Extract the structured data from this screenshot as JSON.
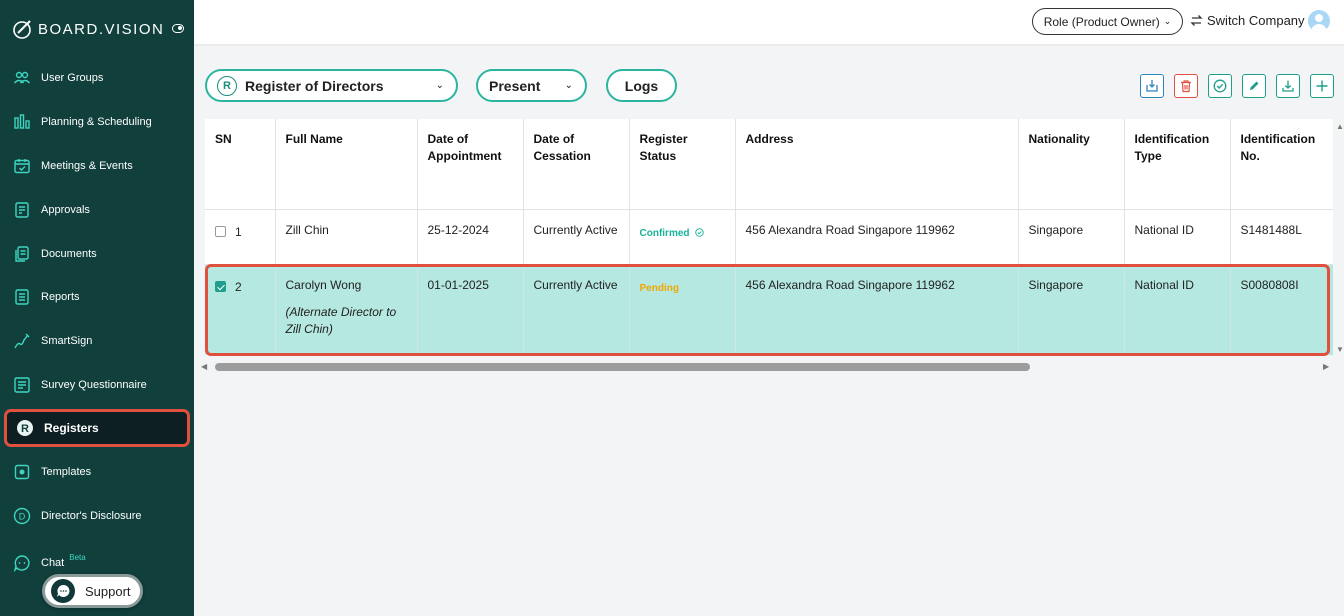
{
  "brand": {
    "name": "BOARD.VISION"
  },
  "sidebar": {
    "items": [
      {
        "label": "User Groups",
        "icon": "user-groups-icon"
      },
      {
        "label": "Planning & Scheduling",
        "icon": "chart-bars-icon"
      },
      {
        "label": "Meetings & Events",
        "icon": "calendar-icon"
      },
      {
        "label": "Approvals",
        "icon": "approvals-icon"
      },
      {
        "label": "Documents",
        "icon": "documents-icon"
      },
      {
        "label": "Reports",
        "icon": "reports-icon"
      },
      {
        "label": "SmartSign",
        "icon": "signature-icon"
      },
      {
        "label": "Survey Questionnaire",
        "icon": "survey-icon"
      },
      {
        "label": "Registers",
        "icon": "registers-icon"
      },
      {
        "label": "Templates",
        "icon": "templates-icon"
      },
      {
        "label": "Director's Disclosure",
        "icon": "disclosure-icon"
      },
      {
        "label": "Chat",
        "icon": "chat-icon",
        "badge": "Beta"
      }
    ],
    "active": "Registers",
    "support_label": "Support"
  },
  "topbar": {
    "role_label": "Role (Product Owner)",
    "switch_company_label": "Switch Company"
  },
  "filters": {
    "register_label": "Register of Directors",
    "register_badge": "R",
    "status_label": "Present",
    "logs_label": "Logs"
  },
  "toolbar": {
    "icons": [
      "import-icon",
      "delete-icon",
      "approve-icon",
      "edit-icon",
      "download-icon",
      "add-icon"
    ]
  },
  "table": {
    "columns": [
      "SN",
      "Full Name",
      "Date of Appointment",
      "Date of Cessation",
      "Register Status",
      "Address",
      "Nationality",
      "Identification Type",
      "Identification No."
    ],
    "rows": [
      {
        "sn": "1",
        "checked": false,
        "full_name": "Zill Chin",
        "note": "",
        "date_appointment": "25-12-2024",
        "date_cessation": "Currently Active",
        "status": "Confirmed",
        "address": "456 Alexandra Road Singapore 119962",
        "nationality": "Singapore",
        "id_type": "National ID",
        "id_no": "S1481488L"
      },
      {
        "sn": "2",
        "checked": true,
        "full_name": "Carolyn Wong",
        "note": "(Alternate Director to Zill Chin)",
        "date_appointment": "01-01-2025",
        "date_cessation": "Currently Active",
        "status": "Pending",
        "address": "456 Alexandra Road Singapore 119962",
        "nationality": "Singapore",
        "id_type": "National ID",
        "id_no": "S0080808I"
      }
    ]
  },
  "colors": {
    "sidebar_bg": "#103f3c",
    "accent": "#2bb5a0",
    "highlight_row": "#b5e8e0",
    "annotation_red": "#e0503f",
    "confirmed": "#16b29a",
    "pending": "#f0a800"
  }
}
